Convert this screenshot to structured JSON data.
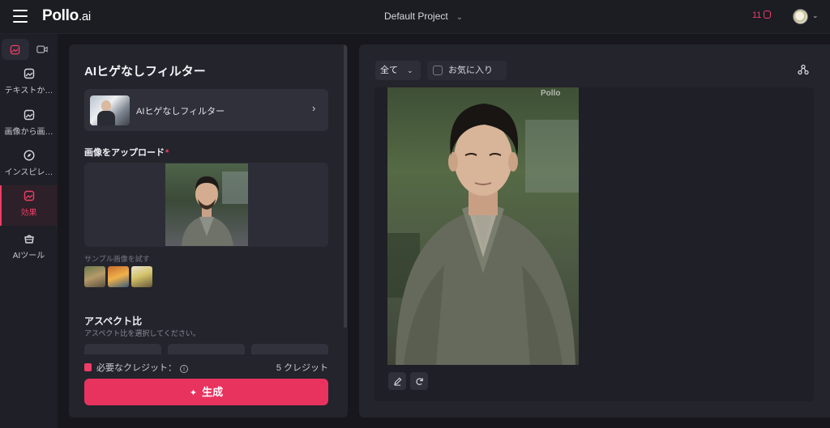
{
  "header": {
    "logo_main": "Pollo",
    "logo_suffix": ".ai",
    "project": "Default Project",
    "credits": "11"
  },
  "rail": {
    "items": [
      {
        "label": "テキストか…"
      },
      {
        "label": "画像から画…"
      },
      {
        "label": "インスピレ…"
      },
      {
        "label": "効果"
      },
      {
        "label": "AIツール"
      }
    ]
  },
  "panel": {
    "title": "AIヒゲなしフィルター",
    "effect_name": "AIヒゲなしフィルター",
    "upload_label": "画像をアップロード",
    "required_mark": "*",
    "sample_label": "サンプル画像を試す",
    "aspect_title": "アスペクト比",
    "aspect_sub": "アスペクト比を選択してください。",
    "credit_label": "必要なクレジット：",
    "credit_cost": "5 クレジット",
    "generate_label": "生成"
  },
  "gallery": {
    "filter_value": "全て",
    "favorites_label": "お気に入り",
    "watermark": "Pollo"
  },
  "colors": {
    "accent": "#e8335f",
    "background": "#17171d",
    "panel": "#24242c"
  },
  "icons": [
    "menu-icon",
    "chevron-down-icon",
    "database-icon",
    "image-icon",
    "video-icon",
    "compass-icon",
    "basket-icon",
    "chevron-right-icon",
    "info-icon",
    "sparkle-icon",
    "share-icon",
    "edit-icon",
    "refresh-icon"
  ]
}
